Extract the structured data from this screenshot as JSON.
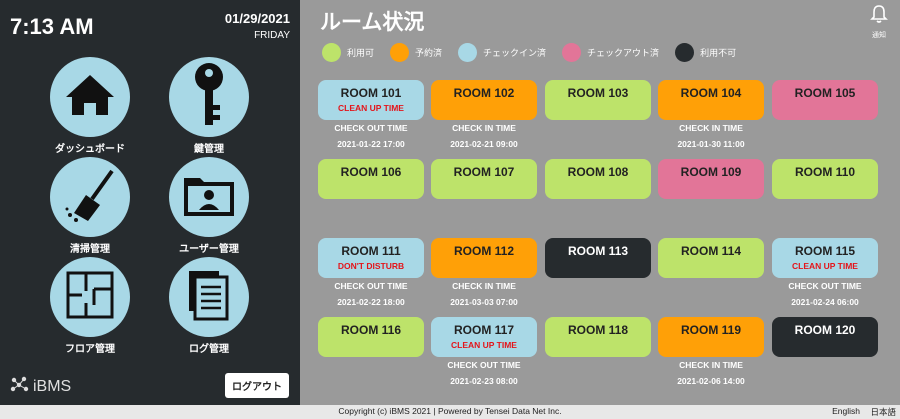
{
  "sidebar": {
    "time": "7:13 AM",
    "date": "01/29/2021",
    "weekday": "FRIDAY",
    "nav": [
      {
        "label": "ダッシュボード",
        "icon": "house-icon"
      },
      {
        "label": "鍵管理",
        "icon": "key-icon"
      },
      {
        "label": "清掃管理",
        "icon": "broom-icon"
      },
      {
        "label": "ユーザー管理",
        "icon": "user-folder-icon"
      },
      {
        "label": "フロア管理",
        "icon": "floor-plan-icon"
      },
      {
        "label": "ログ管理",
        "icon": "documents-icon"
      }
    ],
    "brand": "iBMS",
    "logout_label": "ログアウト"
  },
  "header": {
    "title": "ルーム状況",
    "notify_label": "通知"
  },
  "legend": [
    {
      "label": "利用可",
      "color": "#bde36a"
    },
    {
      "label": "予約済",
      "color": "#ffa007"
    },
    {
      "label": "チェックイン済",
      "color": "#a8d8e6"
    },
    {
      "label": "チェックアウト済",
      "color": "#e27598"
    },
    {
      "label": "利用不可",
      "color": "#262b2e"
    }
  ],
  "rooms": [
    {
      "name": "ROOM 101",
      "color": "#a8d8e6",
      "status": "CLEAN UP TIME",
      "time_label": "CHECK OUT TIME",
      "time": "2021-01-22 17:00"
    },
    {
      "name": "ROOM 102",
      "color": "#ffa007",
      "status": "",
      "time_label": "CHECK IN TIME",
      "time": "2021-02-21 09:00"
    },
    {
      "name": "ROOM 103",
      "color": "#bde36a",
      "status": "",
      "time_label": "",
      "time": ""
    },
    {
      "name": "ROOM 104",
      "color": "#ffa007",
      "status": "",
      "time_label": "CHECK IN TIME",
      "time": "2021-01-30 11:00"
    },
    {
      "name": "ROOM 105",
      "color": "#e27598",
      "status": "",
      "time_label": "",
      "time": ""
    },
    {
      "name": "ROOM 106",
      "color": "#bde36a",
      "status": "",
      "time_label": "",
      "time": ""
    },
    {
      "name": "ROOM 107",
      "color": "#bde36a",
      "status": "",
      "time_label": "",
      "time": ""
    },
    {
      "name": "ROOM 108",
      "color": "#bde36a",
      "status": "",
      "time_label": "",
      "time": ""
    },
    {
      "name": "ROOM 109",
      "color": "#e27598",
      "status": "",
      "time_label": "",
      "time": ""
    },
    {
      "name": "ROOM 110",
      "color": "#bde36a",
      "status": "",
      "time_label": "",
      "time": ""
    },
    {
      "name": "ROOM 111",
      "color": "#a8d8e6",
      "status": "DON'T DISTURB",
      "time_label": "CHECK OUT TIME",
      "time": "2021-02-22 18:00"
    },
    {
      "name": "ROOM 112",
      "color": "#ffa007",
      "status": "",
      "time_label": "CHECK IN TIME",
      "time": "2021-03-03 07:00"
    },
    {
      "name": "ROOM 113",
      "color": "#262b2e",
      "status": "",
      "time_label": "",
      "time": ""
    },
    {
      "name": "ROOM 114",
      "color": "#bde36a",
      "status": "",
      "time_label": "",
      "time": ""
    },
    {
      "name": "ROOM 115",
      "color": "#a8d8e6",
      "status": "CLEAN UP TIME",
      "time_label": "CHECK OUT TIME",
      "time": "2021-02-24 06:00"
    },
    {
      "name": "ROOM 116",
      "color": "#bde36a",
      "status": "",
      "time_label": "",
      "time": ""
    },
    {
      "name": "ROOM 117",
      "color": "#a8d8e6",
      "status": "CLEAN UP TIME",
      "time_label": "CHECK OUT TIME",
      "time": "2021-02-23 08:00"
    },
    {
      "name": "ROOM 118",
      "color": "#bde36a",
      "status": "",
      "time_label": "",
      "time": ""
    },
    {
      "name": "ROOM 119",
      "color": "#ffa007",
      "status": "",
      "time_label": "CHECK IN TIME",
      "time": "2021-02-06 14:00"
    },
    {
      "name": "ROOM 120",
      "color": "#262b2e",
      "status": "",
      "time_label": "",
      "time": ""
    }
  ],
  "footer": {
    "copyright": "Copyright (c) iBMS 2021 | Powered by Tensei Data Net Inc.",
    "lang_en": "English",
    "lang_ja": "日本語"
  }
}
